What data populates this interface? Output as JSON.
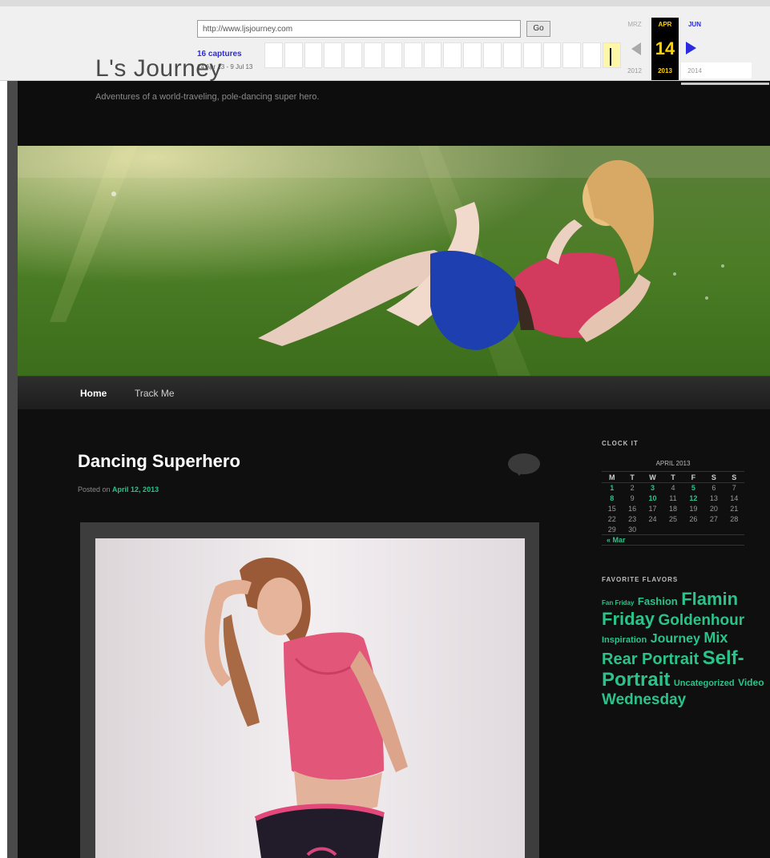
{
  "wayback": {
    "url": "http://www.ljsjourney.com",
    "go_label": "Go",
    "captures": "16 captures",
    "capture_range": "14 Apr 13 - 9 Jul 13",
    "prev_month": "MRZ",
    "current_month": "APR",
    "next_month": "JUN",
    "current_day": "14",
    "prev_year": "2012",
    "current_year": "2013",
    "next_year": "2014"
  },
  "site": {
    "title": "L's Journey",
    "description": "Adventures of a world-traveling, pole-dancing super hero."
  },
  "nav": {
    "items": [
      {
        "label": "Home"
      },
      {
        "label": "Track Me"
      }
    ]
  },
  "post": {
    "title": "Dancing Superhero",
    "meta_prefix": "Posted on",
    "date": "April 12, 2013"
  },
  "sidebar": {
    "calendar_title": "CLOCK IT",
    "calendar_caption": "APRIL 2013",
    "weekdays": [
      "M",
      "T",
      "W",
      "T",
      "F",
      "S",
      "S"
    ],
    "weeks": [
      [
        "1",
        "2",
        "3",
        "4",
        "5",
        "6",
        "7"
      ],
      [
        "8",
        "9",
        "10",
        "11",
        "12",
        "13",
        "14"
      ],
      [
        "15",
        "16",
        "17",
        "18",
        "19",
        "20",
        "21"
      ],
      [
        "22",
        "23",
        "24",
        "25",
        "26",
        "27",
        "28"
      ],
      [
        "29",
        "30",
        "",
        "",
        "",
        "",
        ""
      ]
    ],
    "linked_days": [
      "1",
      "3",
      "5",
      "8",
      "10",
      "12"
    ],
    "prev_month_link": "« Mar",
    "tags_title": "FAVORITE FLAVORS",
    "tags": [
      {
        "label": "Fan Friday",
        "size": 8
      },
      {
        "label": "Fashion",
        "size": 13
      },
      {
        "label": "Flamin Friday",
        "size": 22
      },
      {
        "label": "Goldenhour",
        "size": 19
      },
      {
        "label": "Inspiration",
        "size": 11
      },
      {
        "label": "Journey",
        "size": 16
      },
      {
        "label": "Mix",
        "size": 18
      },
      {
        "label": "Rear Portrait",
        "size": 20
      },
      {
        "label": "Self-Portrait",
        "size": 24
      },
      {
        "label": "Uncategorized",
        "size": 11
      },
      {
        "label": "Video",
        "size": 12
      },
      {
        "label": "Wednesday",
        "size": 19
      }
    ]
  }
}
